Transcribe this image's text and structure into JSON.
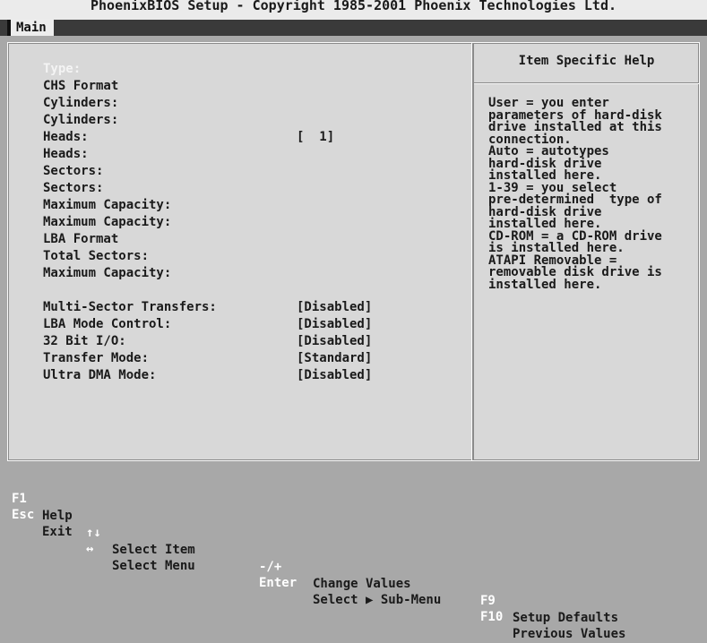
{
  "title": "PhoenixBIOS Setup - Copyright 1985-2001 Phoenix Technologies Ltd.",
  "menu": {
    "active_tab": "Main"
  },
  "settings": {
    "type_label": "Type:",
    "chs_format": "CHS Format",
    "cylinders_1": "Cylinders:",
    "cylinders_2": "Cylinders:",
    "heads_1": "Heads:",
    "heads_1_value": "[  1]",
    "heads_2": "Heads:",
    "sectors_1": "Sectors:",
    "sectors_2": "Sectors:",
    "max_capacity_1": "Maximum Capacity:",
    "max_capacity_2": "Maximum Capacity:",
    "lba_format": "LBA Format",
    "total_sectors": "Total Sectors:",
    "max_capacity_3": "Maximum Capacity:",
    "multi_sector_label": "Multi-Sector Transfers:",
    "multi_sector_value": "[Disabled]",
    "lba_mode_label": "LBA Mode Control:",
    "lba_mode_value": "[Disabled]",
    "bit32_label": "32 Bit I/O:",
    "bit32_value": "[Disabled]",
    "transfer_mode_label": "Transfer Mode:",
    "transfer_mode_value": "[Standard]",
    "udma_label": "Ultra DMA Mode:",
    "udma_value": "[Disabled]"
  },
  "help": {
    "title": "Item Specific Help",
    "text": "User = you enter\nparameters of hard-disk\ndrive installed at this\nconnection.\nAuto = autotypes\nhard-disk drive\ninstalled here.\n1-39 = you select\npre-determined  type of\nhard-disk drive\ninstalled here.\nCD-ROM = a CD-ROM drive\nis installed here.\nATAPI Removable =\nremovable disk drive is\ninstalled here."
  },
  "footer": {
    "row1": {
      "k1": "F1",
      "d1": "Help",
      "k2": "↑↓",
      "d2": "Select Item",
      "k3": "-/+",
      "d3": "Change Values",
      "k4": "F9",
      "d4": "Setup Defaults"
    },
    "row2": {
      "k1": "Esc",
      "d1": "Exit",
      "k2": "↔",
      "d2": "Select Menu",
      "k3": "Enter",
      "d3": "Select ▶ Sub-Menu",
      "k4": "F10",
      "d4": "Previous Values"
    }
  },
  "colors": {
    "background": "#a8a8a8",
    "panel": "#d8d8d8",
    "menu_bar": "#3a3a3a",
    "highlight_text": "#f4f4f4",
    "key_text": "#ffffff"
  }
}
